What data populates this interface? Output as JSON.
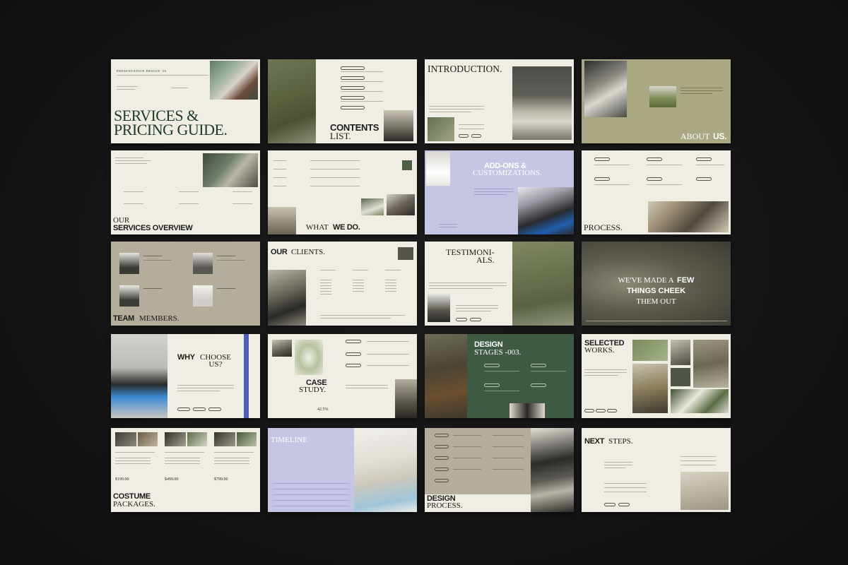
{
  "colors": {
    "background": "#141414",
    "cream": "#efede4",
    "olive": "#a9a883",
    "taupe": "#b4ad9b",
    "lavender": "#c5c6e3",
    "forest": "#3e5a42",
    "dark_green": "#1f3a27",
    "ink": "#1b1b1b"
  },
  "slides": {
    "s1": {
      "kicker": "PRESENTATION DESIGN '26",
      "title": "SERVICES &\nPRICING GUIDE."
    },
    "s2": {
      "title_bold": "CONTENTS",
      "title_light": "LIST."
    },
    "s3": {
      "title": "INTRODUCTION."
    },
    "s4": {
      "title_light": "ABOUT",
      "title_bold": "US."
    },
    "s5": {
      "title_light": "OUR",
      "title_bold": "SERVICES OVERVIEW"
    },
    "s6": {
      "title_light": "WHAT",
      "title_bold": "WE DO."
    },
    "s7": {
      "title_bold": "ADD-ONS &",
      "title_light": "CUSTOMIZATIONS."
    },
    "s8": {
      "title": "PROCESS."
    },
    "s9": {
      "title_bold": "TEAM",
      "title_light": "MEMBERS."
    },
    "s10": {
      "title_bold": "OUR",
      "title_light": "CLIENTS."
    },
    "s11": {
      "title": "TESTIMONI-\nALS."
    },
    "s12": {
      "line1_light": "WE'VE MADE A",
      "line1_bold": "FEW",
      "line2_bold": "THINGS CHEEK",
      "line3_light": "THEM OUT"
    },
    "s13": {
      "title_bold": "WHY",
      "title_light": "CHOOSE\nUS?"
    },
    "s14": {
      "title_bold": "CASE",
      "title_light": "STUDY.",
      "stat": "42.5%"
    },
    "s15": {
      "title_bold": "DESIGN",
      "title_light": "STAGES -003."
    },
    "s16": {
      "title_bold": "SELECTED",
      "title_light": "WORKS."
    },
    "s17": {
      "title_bold": "COSTUME",
      "title_light": "PACKAGES.",
      "prices": [
        "$199.00",
        "$499.00",
        "$799.00"
      ]
    },
    "s18": {
      "title": "TIMELINE"
    },
    "s19": {
      "title_bold": "DESIGN",
      "title_light": "PROCESS."
    },
    "s20": {
      "title_bold": "NEXT",
      "title_light": "STEPS."
    }
  }
}
